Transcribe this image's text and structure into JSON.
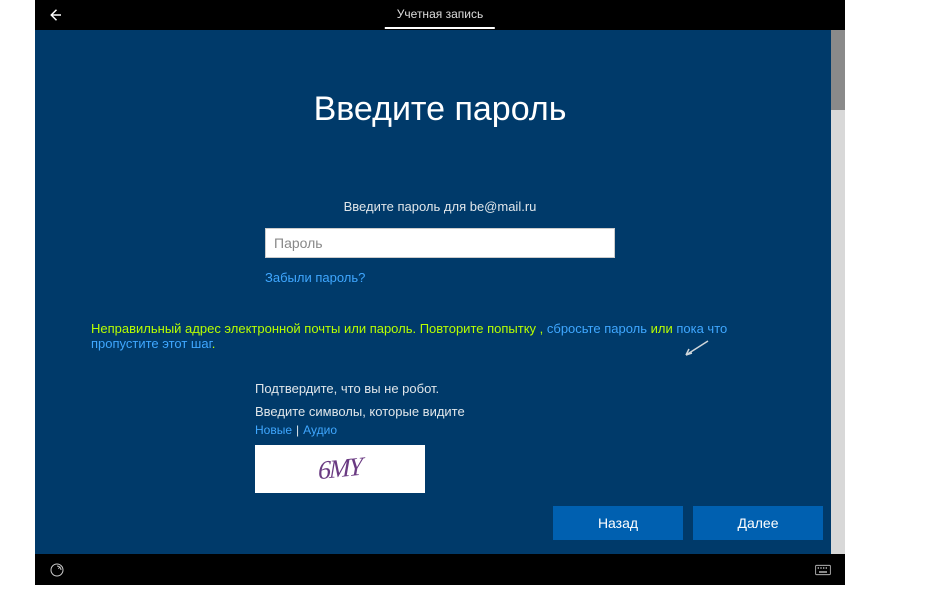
{
  "titlebar": {
    "tab_label": "Учетная запись"
  },
  "main": {
    "heading": "Введите пароль",
    "prompt_prefix": "Введите пароль для ",
    "prompt_email": "be@mail.ru",
    "password_placeholder": "Пароль",
    "forgot_link": "Забыли пароль?"
  },
  "error": {
    "text1": "Неправильный адрес электронной почты или пароль. Повторите попытку",
    "sep1": " , ",
    "link1": "сбросьте пароль",
    "sep2": " или ",
    "link2": "пока что пропустите этот шаг",
    "tail": "."
  },
  "captcha": {
    "line1": "Подтвердите, что вы не робот.",
    "line2": "Введите символы, которые видите",
    "link_new": "Новые",
    "link_audio": "Аудио",
    "image_text": "6MY"
  },
  "buttons": {
    "back": "Назад",
    "next": "Далее"
  }
}
